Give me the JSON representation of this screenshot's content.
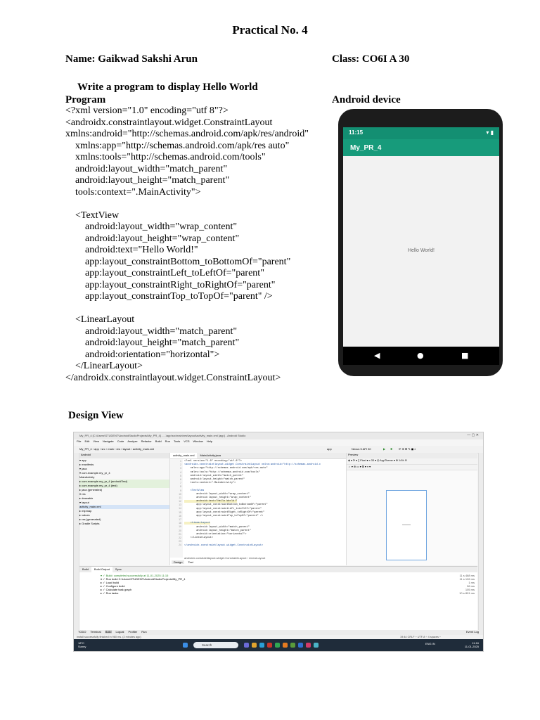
{
  "header": {
    "title": "Practical No. 4",
    "student": "Name: Gaikwad Sakshi Arun",
    "class_info": "Class: CO6I  A  30",
    "aim": "Write a program to display Hello World",
    "program_heading": "Program",
    "device_heading": "Android device",
    "design_heading": "Design View"
  },
  "program_code": [
    "<?xml version=\"1.0\" encoding=\"utf 8\"?>",
    "<androidx.constraintlayout.widget.ConstraintLayout",
    "xmlns:android=\"http://schemas.android.com/apk/res/android\"",
    "    xmlns:app=\"http://schemas.android.com/apk/res auto\"",
    "    xmlns:tools=\"http://schemas.android.com/tools\"",
    "    android:layout_width=\"match_parent\"",
    "    android:layout_height=\"match_parent\"",
    "    tools:context=\".MainActivity\">",
    "",
    "    <TextView",
    "        android:layout_width=\"wrap_content\"",
    "        android:layout_height=\"wrap_content\"",
    "        android:text=\"Hello World!\"",
    "        app:layout_constraintBottom_toBottomOf=\"parent\"",
    "        app:layout_constraintLeft_toLeftOf=\"parent\"",
    "        app:layout_constraintRight_toRightOf=\"parent\"",
    "        app:layout_constraintTop_toTopOf=\"parent\" />",
    "",
    "    <LinearLayout",
    "        android:layout_width=\"match_parent\"",
    "        android:layout_height=\"match_parent\"",
    "        android:orientation=\"horizontal\">",
    "    </LinearLayout>",
    "</androidx.constraintlayout.widget.ConstraintLayout>"
  ],
  "device": {
    "time": "11:15",
    "status_icons": "▾ ▮",
    "app_title": "My_PR_4",
    "hello_text": "Hello World!",
    "nav_back": "◀",
    "nav_home": "●",
    "nav_recent": "■"
  },
  "ide": {
    "window_title": "My_PR_4 [C:\\Users\\STUDENT\\AndroidStudioProjects\\My_PR_4] - ...\\app\\src\\main\\res\\layout\\activity_main.xml [app] - Android Studio",
    "menu": [
      "File",
      "Edit",
      "View",
      "Navigate",
      "Code",
      "Analyze",
      "Refactor",
      "Build",
      "Run",
      "Tools",
      "VCS",
      "Window",
      "Help"
    ],
    "breadcrumb": "My_PR_4 › app › src › main › res › layout › activity_main.xml",
    "run_config": "app",
    "device_select": "Nexus 5 API 30",
    "project_header": "Android",
    "project_tree": [
      "▾ app",
      "   ▸ manifests",
      "   ▾ java",
      "      ▾ com.example.my_pr_4",
      "            MainActivity",
      "      ▸ com.example.my_pr_4 (androidTest)",
      "      ▸ com.example.my_pr_4 (test)",
      "   ▸ java (generated)",
      "   ▾ res",
      "      ▸ drawable",
      "      ▾ layout",
      "            activity_main.xml",
      "      ▸ mipmap",
      "      ▸ values",
      "   ▸ res (generated)",
      "▸ Gradle Scripts"
    ],
    "editor_tabs": [
      "activity_main.xml",
      "MainActivity.java"
    ],
    "editor_code": [
      "<?xml version=\"1.0\" encoding=\"utf-8\"?>",
      "<androidx.constraintlayout.widget.ConstraintLayout xmlns:android=\"http://schemas.android.c",
      "    xmlns:app=\"http://schemas.android.com/apk/res-auto\"",
      "    xmlns:tools=\"http://schemas.android.com/tools\"",
      "    android:layout_width=\"match_parent\"",
      "    android:layout_height=\"match_parent\"",
      "    tools:context=\".MainActivity\">",
      "",
      "    <TextView",
      "        android:layout_width=\"wrap_content\"",
      "        android:layout_height=\"wrap_content\"",
      "        android:text=\"Hello World!\"",
      "        app:layout_constraintBottom_toBottomOf=\"parent\"",
      "        app:layout_constraintLeft_toLeftOf=\"parent\"",
      "        app:layout_constraintRight_toRightOf=\"parent\"",
      "        app:layout_constraintTop_toTopOf=\"parent\" />",
      "",
      "    <LinearLayout",
      "        android:layout_width=\"match_parent\"",
      "        android:layout_height=\"match_parent\"",
      "        android:orientation=\"horizontal\">",
      "    </LinearLayout>",
      "",
      "</androidx.constraintlayout.widget.ConstraintLayout>"
    ],
    "editor_crumbs": "androidx.constraintlayout.widget.ConstraintLayout  ›  LinearLayout",
    "editor_bottom_tabs": [
      "Design",
      "Text"
    ],
    "preview_header": "Preview",
    "preview_toolbar": "◈ ▾  ⟳  ▾   ▯ Pixel ▾   ≡ 33 ▾   ◎ AppTheme ▾      ⊕ 14%  ⊖",
    "preview_toolbar2": "⇔ ▾  ⊕  ▭ ▾  ⊞ ▾  ≡ ▾",
    "build_tabs": [
      "Build",
      "Build Output",
      "Sync"
    ],
    "build_lines": [
      "▾ ✓ Build: completed successfully at 11-01-2025 11:15",
      "   ▾ ✓ Run build  C:\\Users\\STUDENT\\AndroidStudioProjects\\My_PR_4",
      "      ▸ ✓ Load build",
      "      ▸ ✓ Configure build",
      "      ▸ ✓ Calculate task graph",
      "      ▸ ✓ Run tasks"
    ],
    "build_times": [
      "11 s 468 ms",
      "11 s 126 ms",
      "1 ms",
      "96 ms",
      "105 ms",
      "10 s 801 ms"
    ],
    "bottom_tabs": [
      "TODO",
      "Terminal",
      "Build",
      "Logcat",
      "Profiler",
      "Run"
    ],
    "event_log": "Event Log",
    "status_message": "Install successfully finished in 960 ms. (2 minutes ago)",
    "status_right": "19:44   CRLF ÷   UTF-8 ÷   4 spaces ÷",
    "taskbar_weather": "18°C",
    "taskbar_weather2": "Sunny",
    "taskbar_search": "Search",
    "taskbar_lang": "ENG IN",
    "taskbar_time": "11:16",
    "taskbar_date": "11-01-2025"
  }
}
